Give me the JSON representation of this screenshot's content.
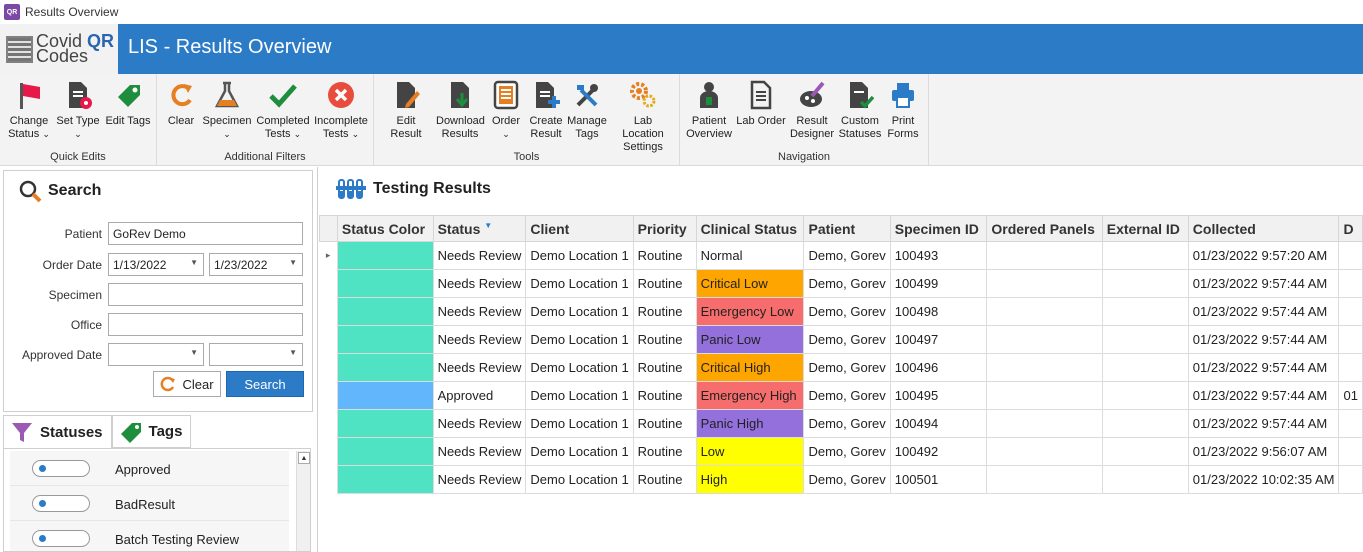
{
  "window": {
    "title": "Results Overview"
  },
  "header": {
    "logo_line1": "Covid",
    "logo_line1_bold": "QR",
    "logo_line2": "Codes",
    "app_title": "LIS - Results Overview",
    "color": "#2b7bc6"
  },
  "ribbon": {
    "groups": [
      {
        "title": "Quick Edits"
      },
      {
        "title": "Additional Filters"
      },
      {
        "title": "Tools"
      },
      {
        "title": "Navigation"
      }
    ],
    "buttons": {
      "change_status": [
        "Change",
        "Status"
      ],
      "set_type": [
        "Set Type",
        ""
      ],
      "edit_tags": [
        "Edit Tags"
      ],
      "clear": [
        "Clear"
      ],
      "specimen": [
        "Specimen",
        ""
      ],
      "completed_tests": [
        "Completed",
        "Tests"
      ],
      "incomplete_tests": [
        "Incomplete",
        "Tests"
      ],
      "edit_result": [
        "Edit Result"
      ],
      "download_results": [
        "Download",
        "Results"
      ],
      "order": [
        "Order",
        ""
      ],
      "create_result": [
        "Create",
        "Result"
      ],
      "manage_tags": [
        "Manage",
        "Tags"
      ],
      "lab_location_settings": [
        "Lab Location",
        "Settings"
      ],
      "patient_overview": [
        "Patient",
        "Overview"
      ],
      "lab_order": [
        "Lab Order"
      ],
      "result_designer": [
        "Result",
        "Designer"
      ],
      "custom_statuses": [
        "Custom",
        "Statuses"
      ],
      "print_forms": [
        "Print",
        "Forms"
      ]
    }
  },
  "search": {
    "title": "Search",
    "patient_label": "Patient",
    "patient_value": "GoRev Demo",
    "order_date_label": "Order Date",
    "order_date_from": "1/13/2022",
    "order_date_to": "1/23/2022",
    "specimen_label": "Specimen",
    "specimen_value": "",
    "office_label": "Office",
    "office_value": "",
    "approved_date_label": "Approved Date",
    "approved_date_from": "",
    "approved_date_to": "",
    "clear_label": "Clear",
    "search_label": "Search"
  },
  "tabs": {
    "statuses": "Statuses",
    "tags": "Tags"
  },
  "statuses": [
    {
      "label": "Approved"
    },
    {
      "label": "BadResult"
    },
    {
      "label": "Batch Testing Review"
    }
  ],
  "results": {
    "title": "Testing Results",
    "columns": [
      "Status Color",
      "Status",
      "Client",
      "Priority",
      "Clinical Status",
      "Patient",
      "Specimen ID",
      "Ordered Panels",
      "External ID",
      "Collected",
      "D"
    ],
    "rows": [
      {
        "status_color": "#4fe3c4",
        "status": "Needs Review",
        "client": "Demo Location 1",
        "priority": "Routine",
        "clinical": "Normal",
        "clinical_color": "#ffffff",
        "patient": "Demo, Gorev",
        "specimen": "100493",
        "panels": "",
        "external": "",
        "collected": "01/23/2022 9:57:20 AM",
        "d": ""
      },
      {
        "status_color": "#4fe3c4",
        "status": "Needs Review",
        "client": "Demo Location 1",
        "priority": "Routine",
        "clinical": "Critical Low",
        "clinical_color": "#ffa500",
        "patient": "Demo, Gorev",
        "specimen": "100499",
        "panels": "",
        "external": "",
        "collected": "01/23/2022 9:57:44 AM",
        "d": ""
      },
      {
        "status_color": "#4fe3c4",
        "status": "Needs Review",
        "client": "Demo Location 1",
        "priority": "Routine",
        "clinical": "Emergency Low",
        "clinical_color": "#f76d6d",
        "patient": "Demo, Gorev",
        "specimen": "100498",
        "panels": "",
        "external": "",
        "collected": "01/23/2022 9:57:44 AM",
        "d": ""
      },
      {
        "status_color": "#4fe3c4",
        "status": "Needs Review",
        "client": "Demo Location 1",
        "priority": "Routine",
        "clinical": "Panic Low",
        "clinical_color": "#9370db",
        "patient": "Demo, Gorev",
        "specimen": "100497",
        "panels": "",
        "external": "",
        "collected": "01/23/2022 9:57:44 AM",
        "d": ""
      },
      {
        "status_color": "#4fe3c4",
        "status": "Needs Review",
        "client": "Demo Location 1",
        "priority": "Routine",
        "clinical": "Critical High",
        "clinical_color": "#ffa500",
        "patient": "Demo, Gorev",
        "specimen": "100496",
        "panels": "",
        "external": "",
        "collected": "01/23/2022 9:57:44 AM",
        "d": ""
      },
      {
        "status_color": "#62b6fb",
        "status": "Approved",
        "client": "Demo Location 1",
        "priority": "Routine",
        "clinical": "Emergency High",
        "clinical_color": "#f76d6d",
        "patient": "Demo, Gorev",
        "specimen": "100495",
        "panels": "",
        "external": "",
        "collected": "01/23/2022 9:57:44 AM",
        "d": "01"
      },
      {
        "status_color": "#4fe3c4",
        "status": "Needs Review",
        "client": "Demo Location 1",
        "priority": "Routine",
        "clinical": "Panic High",
        "clinical_color": "#9370db",
        "patient": "Demo, Gorev",
        "specimen": "100494",
        "panels": "",
        "external": "",
        "collected": "01/23/2022 9:57:44 AM",
        "d": ""
      },
      {
        "status_color": "#4fe3c4",
        "status": "Needs Review",
        "client": "Demo Location 1",
        "priority": "Routine",
        "clinical": "Low",
        "clinical_color": "#ffff00",
        "patient": "Demo, Gorev",
        "specimen": "100492",
        "panels": "",
        "external": "",
        "collected": "01/23/2022 9:56:07 AM",
        "d": ""
      },
      {
        "status_color": "#4fe3c4",
        "status": "Needs Review",
        "client": "Demo Location 1",
        "priority": "Routine",
        "clinical": "High",
        "clinical_color": "#ffff00",
        "patient": "Demo, Gorev",
        "specimen": "100501",
        "panels": "",
        "external": "",
        "collected": "01/23/2022 10:02:35 AM",
        "d": ""
      }
    ]
  }
}
